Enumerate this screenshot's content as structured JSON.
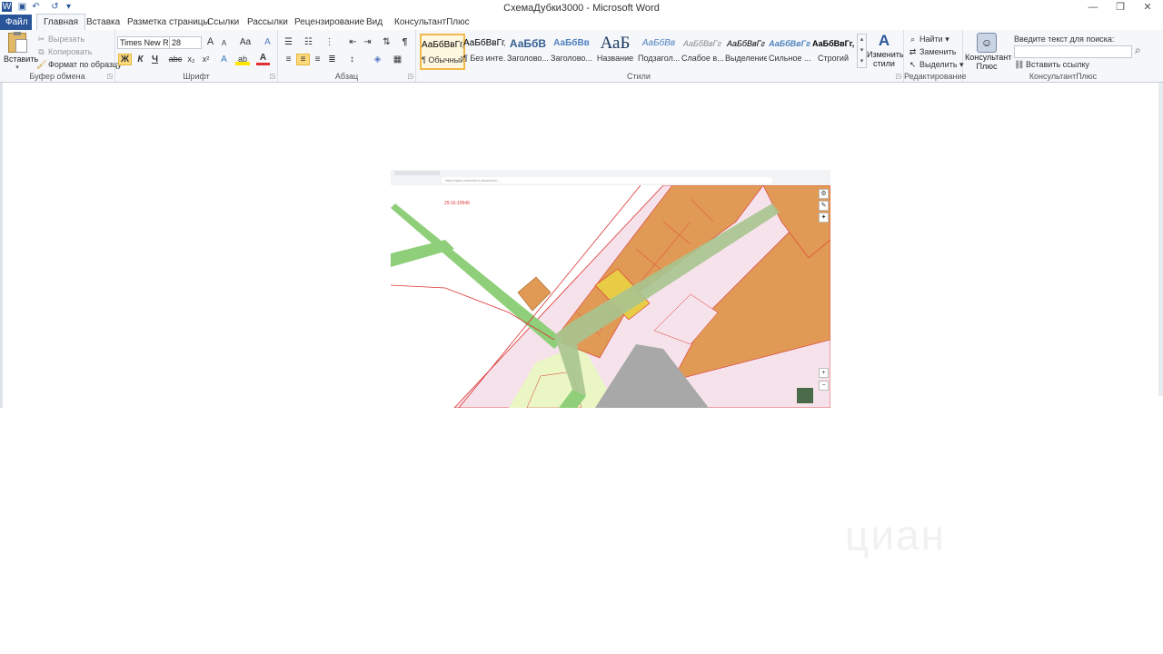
{
  "window": {
    "title": "СхемаДубки3000 - Microsoft Word",
    "controls": [
      "—",
      "❐",
      "✕"
    ]
  },
  "tabs": [
    "Файл",
    "Главная",
    "Вставка",
    "Разметка страницы",
    "Ссылки",
    "Рассылки",
    "Рецензирование",
    "Вид",
    "КонсультантПлюс"
  ],
  "clipboard": {
    "paste": "Вставить",
    "cut": "Вырезать",
    "copy": "Копировать",
    "format_painter": "Формат по образцу",
    "label": "Буфер обмена"
  },
  "font": {
    "name": "Times New Ro",
    "size": "28",
    "label": "Шрифт",
    "bold": "Ж",
    "italic": "К",
    "underline": "Ч",
    "strike": "abc",
    "sub": "x₂",
    "sup": "x²",
    "case": "Aa",
    "grow": "A",
    "shrink": "A",
    "clear": "A",
    "highlight": "ab",
    "color": "A"
  },
  "paragraph": {
    "label": "Абзац",
    "pilcrow": "¶"
  },
  "styles": {
    "label": "Стили",
    "items": [
      {
        "sample": "АаБбВвГг,",
        "name": "¶ Обычный"
      },
      {
        "sample": "АаБбВвГг,",
        "name": "¶ Без инте..."
      },
      {
        "sample": "АаБбВ",
        "name": "Заголово..."
      },
      {
        "sample": "АаБбВв",
        "name": "Заголово..."
      },
      {
        "sample": "АаБ",
        "name": "Название"
      },
      {
        "sample": "АаБбВв",
        "name": "Подзагол..."
      },
      {
        "sample": "АаБбВвГг",
        "name": "Слабое в..."
      },
      {
        "sample": "АаБбВвГг",
        "name": "Выделение"
      },
      {
        "sample": "АаБбВвГг",
        "name": "Сильное ..."
      },
      {
        "sample": "АаБбВвГг,",
        "name": "Строгий"
      }
    ],
    "change": "Изменить стили"
  },
  "editing": {
    "label": "Редактирование",
    "find": "Найти",
    "replace": "Заменить",
    "select": "Выделить"
  },
  "consultant": {
    "label": "КонсультантПлюс",
    "button": "Консультант Плюс",
    "search_label": "Введите текст для поиска:",
    "insert_link": "Вставить ссылку"
  },
  "map": {
    "parcel_label": "29:16:10649",
    "browser_url": "https://pkk.rosreestr.ru/#/search/...",
    "zoom_in": "+",
    "zoom_out": "−"
  },
  "watermark": "циан",
  "colors": {
    "accent": "#2a5699",
    "parcel_orange": "#e09a55",
    "parcel_yellow": "#e8cc45",
    "road_green": "#8fcf7a",
    "land_pink": "#f6e7ee",
    "border_red": "#d33"
  }
}
